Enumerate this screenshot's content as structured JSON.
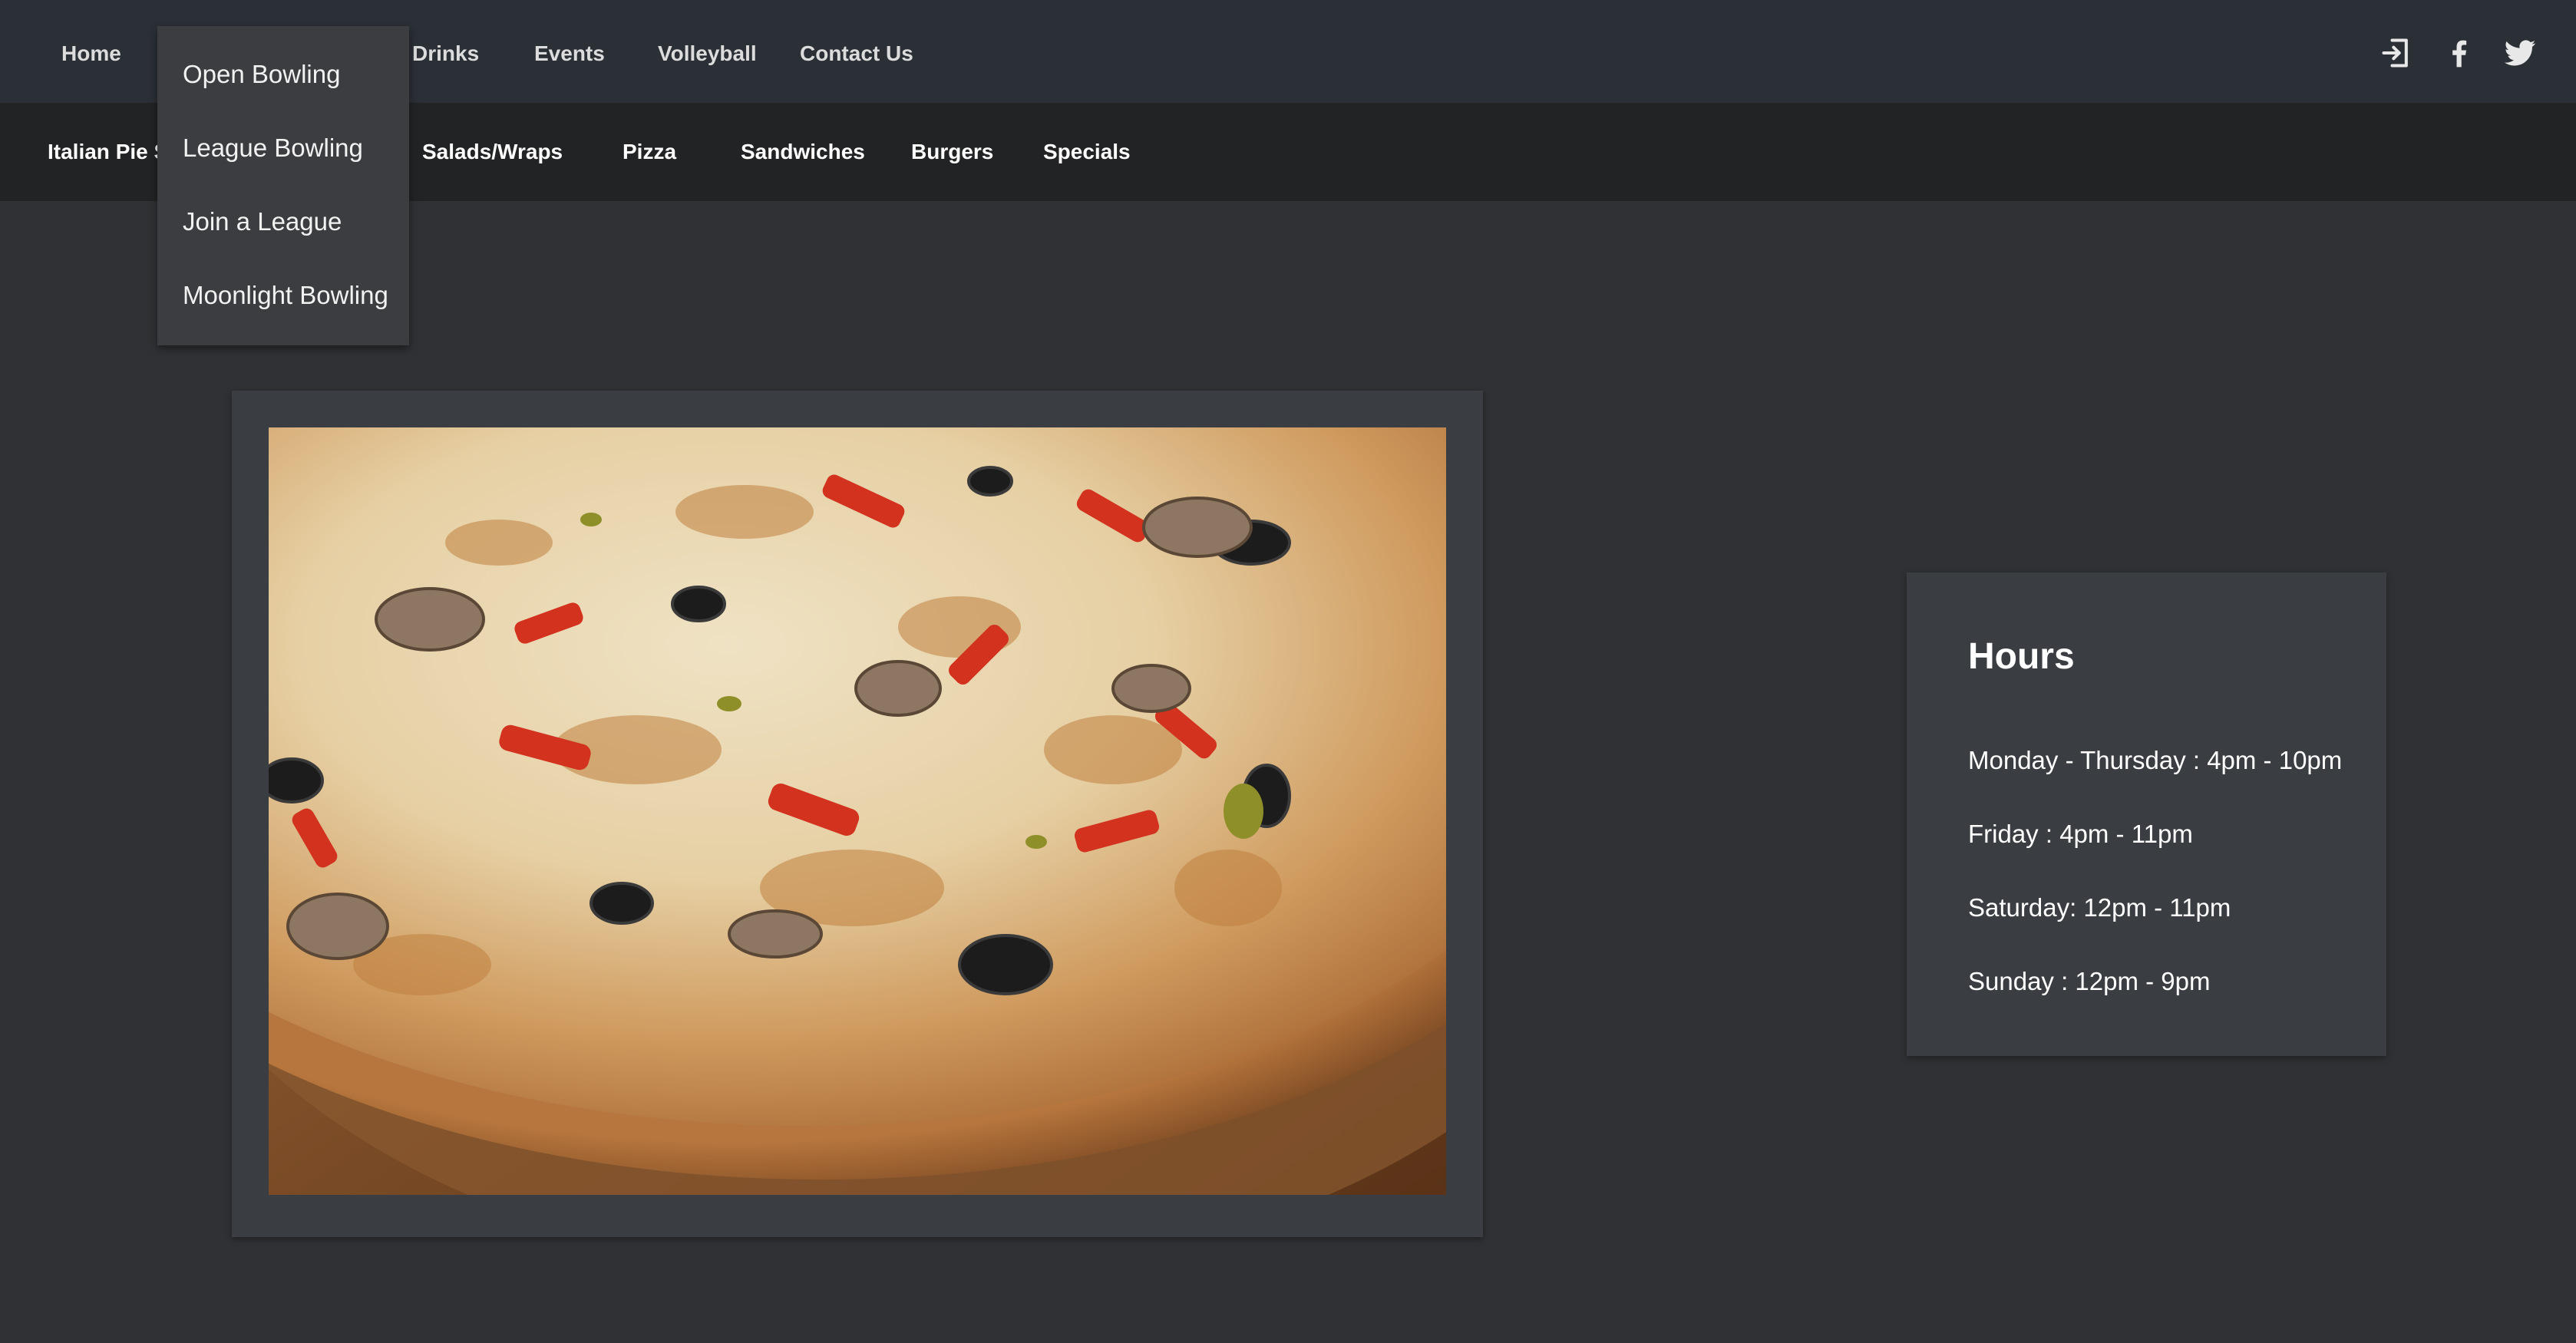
{
  "top_nav": {
    "items": [
      "Home",
      "Drinks",
      "Events",
      "Volleyball",
      "Contact Us"
    ],
    "icons": [
      "sign-in-icon",
      "facebook-icon",
      "twitter-icon"
    ]
  },
  "sub_nav": {
    "items": [
      "Italian Pie S",
      "Salads/Wraps",
      "Pizza",
      "Sandwiches",
      "Burgers",
      "Specials"
    ]
  },
  "dropdown": {
    "items": [
      "Open Bowling",
      "League Bowling",
      "Join a League",
      "Moonlight Bowling"
    ]
  },
  "hero_image": {
    "subject": "pizza-on-wooden-board"
  },
  "hours": {
    "title": "Hours",
    "lines": [
      "Monday - Thursday : 4pm - 10pm",
      "Friday : 4pm - 11pm",
      "Saturday: 12pm - 11pm",
      "Sunday : 12pm - 9pm"
    ]
  },
  "colors": {
    "page_bg": "#2f3134",
    "top_nav_bg": "#2b3036",
    "sub_nav_bg": "#212325",
    "card_bg": "#3a3d41",
    "dropdown_bg": "#3b3d40"
  }
}
